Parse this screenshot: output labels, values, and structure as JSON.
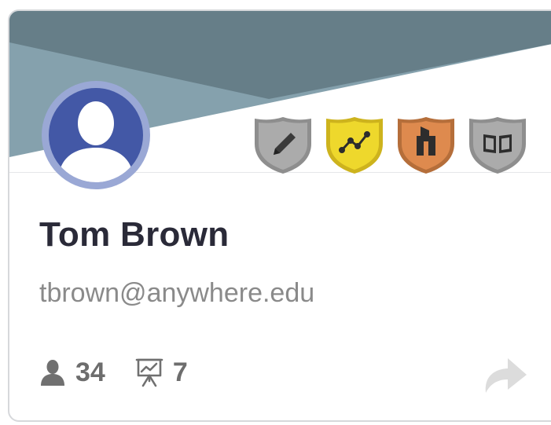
{
  "profile": {
    "name": "Tom Brown",
    "email": "tbrown@anywhere.edu"
  },
  "stats": {
    "followers": "34",
    "presentations": "7"
  },
  "badges": [
    {
      "icon": "pencil-icon",
      "color": "#a6a6a6"
    },
    {
      "icon": "line-chart-icon",
      "color": "#e8cf2a"
    },
    {
      "icon": "building-icon",
      "color": "#d4854a"
    },
    {
      "icon": "book-icon",
      "color": "#a6a6a6"
    }
  ],
  "colors": {
    "banner_dark": "#667e88",
    "banner_light": "#85a1ad",
    "avatar_blue": "#4358a6",
    "name_text": "#2a2a38",
    "muted_text": "#8a8a8a"
  }
}
